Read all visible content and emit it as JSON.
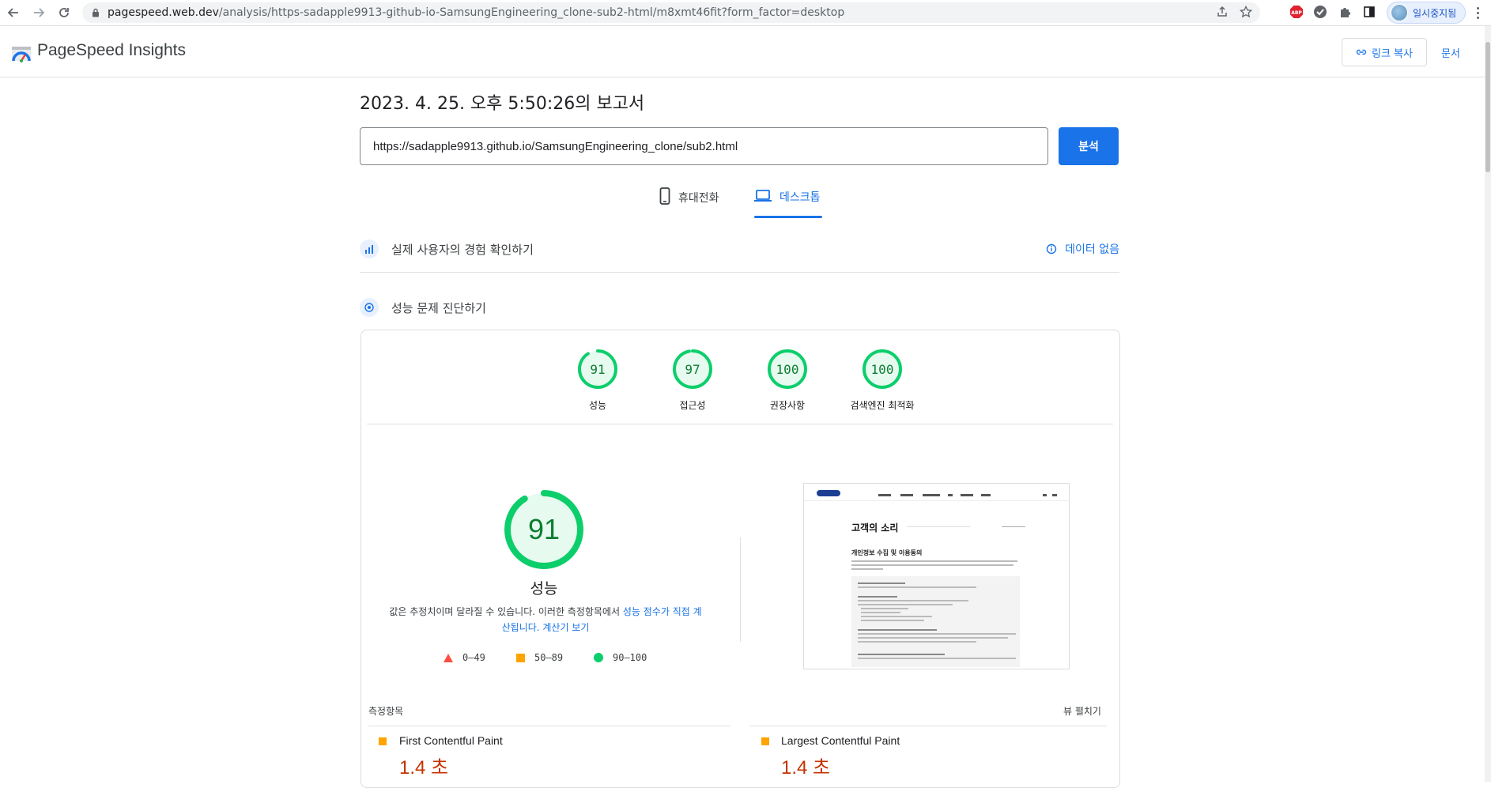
{
  "browser": {
    "url_host": "pagespeed.web.dev",
    "url_path": "/analysis/https-sadapple9913-github-io-SamsungEngineering_clone-sub2-html/m8xmt46fit?form_factor=desktop",
    "profile_label": "일시중지됨",
    "abp_label": "ABP"
  },
  "app": {
    "brand": "PageSpeed Insights",
    "copy_link_label": "링크 복사",
    "docs_label": "문서"
  },
  "report": {
    "title": "2023. 4. 25. 오후 5:50:26의 보고서",
    "url_value": "https://sadapple9913.github.io/SamsungEngineering_clone/sub2.html",
    "analyze_label": "분석"
  },
  "tabs": {
    "mobile": "휴대전화",
    "desktop": "데스크톱",
    "active": "desktop"
  },
  "sections": {
    "field_data_label": "실제 사용자의 경험 확인하기",
    "no_data_label": "데이터 없음",
    "lab_label": "성능 문제 진단하기"
  },
  "scores": [
    {
      "value": "91",
      "label": "성능",
      "fraction": 0.91
    },
    {
      "value": "97",
      "label": "접근성",
      "fraction": 0.97
    },
    {
      "value": "100",
      "label": "권장사항",
      "fraction": 1.0
    },
    {
      "value": "100",
      "label": "검색엔진 최적화",
      "fraction": 1.0
    }
  ],
  "performance": {
    "value": "91",
    "fraction": 0.91,
    "label": "성능",
    "disclaimer_prefix": "값은 추정치이며 달라질 수 있습니다. 이러한 측정항목에서 ",
    "disclaimer_link1": "성능 점수가 직접 계산됩니다.",
    "disclaimer_link2": "계산기 보기"
  },
  "legend": {
    "fail": "0–49",
    "average": "50–89",
    "pass": "90–100"
  },
  "screenshot": {
    "title": "고객의 소리",
    "subtitle": "개인정보 수집 및 이용동의"
  },
  "metrics": {
    "header": "측정항목",
    "expand_label": "뷰 펼치기",
    "items": [
      {
        "name": "First Contentful Paint",
        "value": "1.4 초"
      },
      {
        "name": "Largest Contentful Paint",
        "value": "1.4 초"
      }
    ]
  },
  "colors": {
    "accent": "#1a73e8",
    "pass": "#0cce6b",
    "pass_text": "#0c7d2f",
    "average": "#ffa400",
    "fail": "#ff4e42",
    "average_value": "#c33300"
  }
}
